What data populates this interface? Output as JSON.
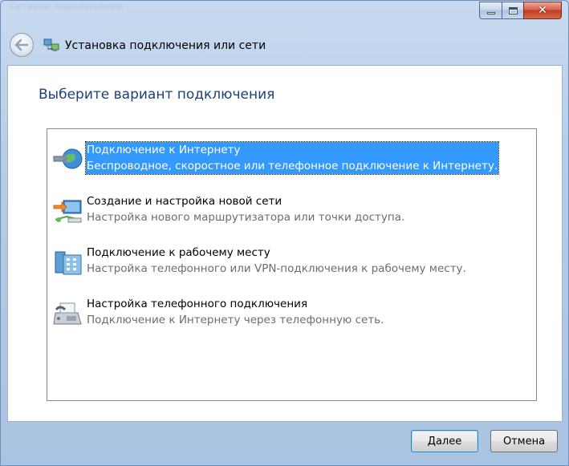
{
  "window": {
    "ghost_title": "Сетевое подключение",
    "caption_icons": [
      "minimize-icon",
      "maximize-icon",
      "close-icon"
    ]
  },
  "nav": {
    "back_icon": "back-arrow-icon",
    "wizard_icon": "network-connection-icon",
    "title": "Установка подключения или сети"
  },
  "main": {
    "heading": "Выберите вариант подключения",
    "options": [
      {
        "icon": "globe-connect-icon",
        "title": "Подключение к Интернету",
        "description": "Беспроводное, скоростное или телефонное подключение к Интернету.",
        "selected": true
      },
      {
        "icon": "router-setup-icon",
        "title": "Создание и настройка новой сети",
        "description": "Настройка нового маршрутизатора или точки доступа.",
        "selected": false
      },
      {
        "icon": "workplace-building-icon",
        "title": "Подключение к рабочему месту",
        "description": "Настройка телефонного или VPN-подключения к рабочему месту.",
        "selected": false
      },
      {
        "icon": "fax-phone-icon",
        "title": "Настройка телефонного подключения",
        "description": "Подключение к Интернету через телефонную сеть.",
        "selected": false
      }
    ]
  },
  "footer": {
    "next_label": "Далее",
    "cancel_label": "Отмена"
  },
  "colors": {
    "heading": "#1e3f7a",
    "selection": "#3399ff",
    "description": "#6d6d6d"
  }
}
